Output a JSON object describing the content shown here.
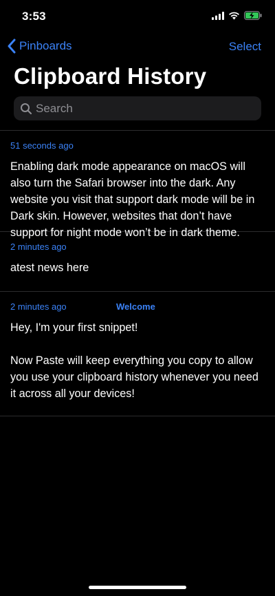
{
  "status_bar": {
    "time": "3:53"
  },
  "nav": {
    "back_label": "Pinboards",
    "select_label": "Select"
  },
  "title": "Clipboard History",
  "search": {
    "placeholder": "Search",
    "value": ""
  },
  "items": [
    {
      "time": "51 seconds ago",
      "tag": "",
      "text": "Enabling dark mode appearance on macOS will also turn the Safari browser into the dark. Any website you visit that support dark mode will be in Dark skin. However, websites that don’t have support for night mode won’t be in dark theme."
    },
    {
      "time": "2 minutes ago",
      "tag": "",
      "text": "atest news here"
    },
    {
      "time": "2 minutes ago",
      "tag": "Welcome",
      "text": "Hey, I'm your first snippet!\n\nNow Paste will keep everything you copy to allow you use your clipboard history whenever you need it across all your devices!"
    }
  ],
  "colors": {
    "accent": "#3b82f6",
    "background": "#000000",
    "search_bg": "#1c1c1e",
    "battery": "#34c759"
  }
}
